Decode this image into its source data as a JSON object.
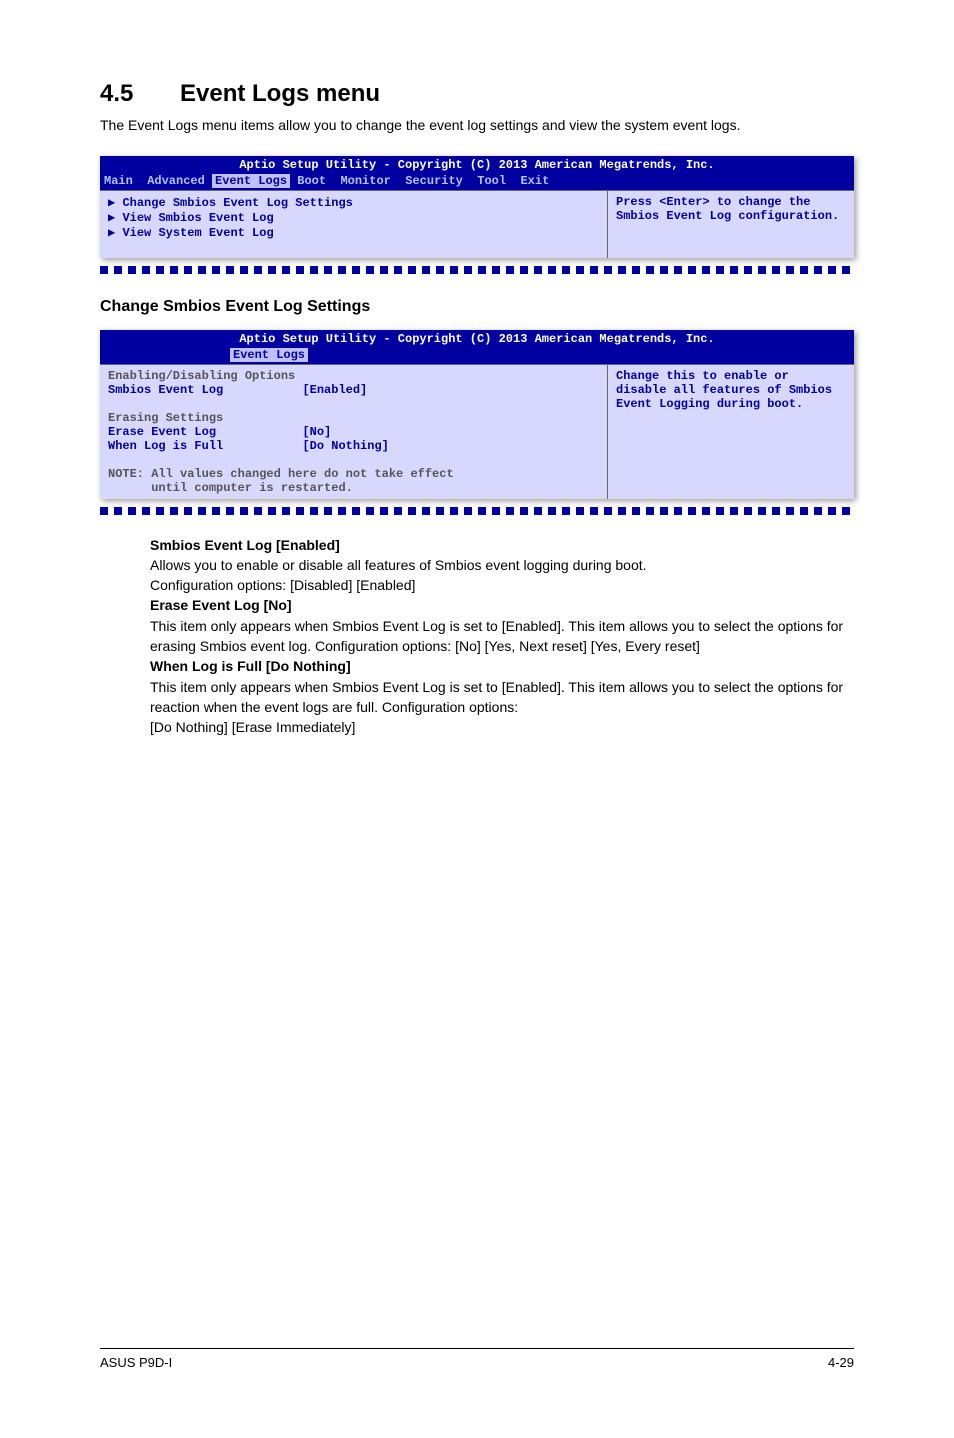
{
  "section": {
    "number": "4.5",
    "title": "Event Logs menu"
  },
  "intro": "The Event Logs menu items allow you to change the event log settings and view the system event logs.",
  "bios1": {
    "title": "Aptio Setup Utility - Copyright (C) 2013 American Megatrends, Inc.",
    "tabs_before": "Main  Advanced ",
    "tab_active": "Event Logs",
    "tabs_after": " Boot  Monitor  Security  Tool  Exit",
    "left1": "Change Smbios Event Log Settings",
    "left2": "View Smbios Event Log",
    "left3": "View System Event Log",
    "help": "Press <Enter> to change the Smbios Event Log configuration."
  },
  "subhead1": "Change Smbios Event Log Settings",
  "bios2": {
    "title": "Aptio Setup Utility - Copyright (C) 2013 American Megatrends, Inc.",
    "tab_active": "Event Logs",
    "h1": "Enabling/Disabling Options",
    "r1_label": "Smbios Event Log",
    "r1_value": "[Enabled]",
    "h2": "Erasing Settings",
    "r2_label": "Erase Event Log",
    "r2_value": "[No]",
    "r3_label": "When Log is Full",
    "r3_value": "[Do Nothing]",
    "note1": "NOTE: All values changed here do not take effect",
    "note2": "      until computer is restarted.",
    "help": "Change this to enable or disable all features of Smbios Event Logging during boot."
  },
  "desc": {
    "d1_title": "Smbios Event Log [Enabled]",
    "d1_line1": "Allows you to enable or disable all features of Smbios event logging during boot.",
    "d1_line2": "Configuration options: [Disabled] [Enabled]",
    "d2_title": "Erase Event Log [No]",
    "d2_line1": "This item only appears when Smbios Event Log is set to [Enabled]. This item allows you to select the options for erasing Smbios event log. Configuration options: [No] [Yes, Next reset] [Yes, Every reset]",
    "d3_title": "When Log is Full [Do Nothing]",
    "d3_line1": "This item only appears when Smbios Event Log is set to [Enabled]. This item allows you to select the options for reaction when the event logs are full. Configuration options:",
    "d3_line2": "[Do Nothing] [Erase Immediately]"
  },
  "footer": {
    "left": "ASUS P9D-I",
    "right": "4-29"
  }
}
